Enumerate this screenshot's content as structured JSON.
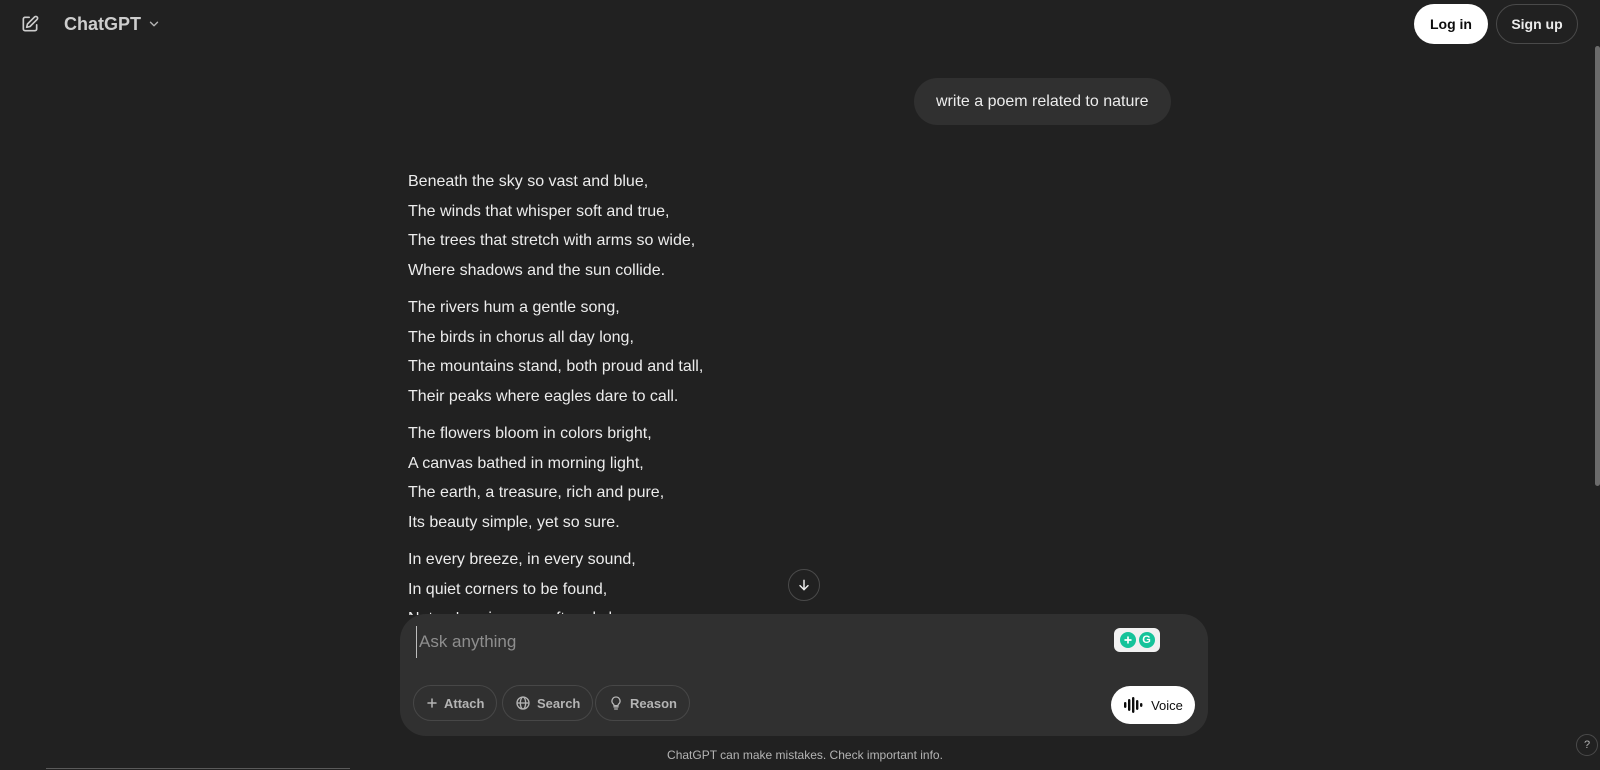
{
  "header": {
    "model_name": "ChatGPT",
    "login_label": "Log in",
    "signup_label": "Sign up"
  },
  "conversation": {
    "user_message": "write a poem related to nature",
    "assistant_stanzas": [
      [
        "Beneath the sky so vast and blue,",
        "The winds that whisper soft and true,",
        "The trees that stretch with arms so wide,",
        "Where shadows and the sun collide."
      ],
      [
        "The rivers hum a gentle song,",
        "The birds in chorus all day long,",
        "The mountains stand, both proud and tall,",
        "Their peaks where eagles dare to call."
      ],
      [
        "The flowers bloom in colors bright,",
        "A canvas bathed in morning light,",
        "The earth, a treasure, rich and pure,",
        "Its beauty simple, yet so sure."
      ],
      [
        "In every breeze, in every sound,",
        "In quiet corners to be found,",
        "Nature's voice, so soft and clear,"
      ]
    ]
  },
  "composer": {
    "placeholder": "Ask anything",
    "attach_label": "Attach",
    "search_label": "Search",
    "reason_label": "Reason",
    "voice_label": "Voice"
  },
  "footer": {
    "disclaimer": "ChatGPT can make mistakes. Check important info.",
    "help_label": "?"
  },
  "colors": {
    "background": "#212121",
    "surface": "#303030",
    "text": "#ececec",
    "muted": "#b4b4b4",
    "grammarly_green": "#15c39a"
  },
  "icons": {
    "new_chat": "edit-pencil-icon",
    "model_dropdown": "chevron-down-icon",
    "scroll_down": "arrow-down-icon",
    "attach": "plus-icon",
    "search": "globe-icon",
    "reason": "lightbulb-icon",
    "voice": "sound-wave-icon",
    "grammarly": "grammarly-icon"
  }
}
